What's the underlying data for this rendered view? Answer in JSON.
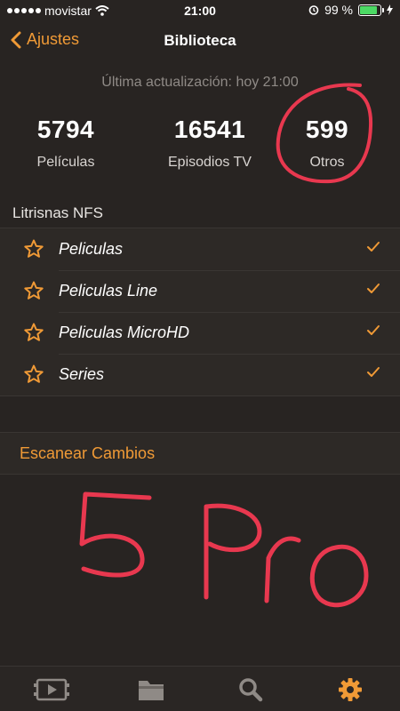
{
  "status": {
    "carrier": "movistar",
    "time": "21:00",
    "battery": "99 %"
  },
  "nav": {
    "back_label": "Ajustes",
    "title": "Biblioteca"
  },
  "updated": "Última actualización: hoy 21:00",
  "stats": [
    {
      "value": "5794",
      "label": "Películas"
    },
    {
      "value": "16541",
      "label": "Episodios TV"
    },
    {
      "value": "599",
      "label": "Otros"
    }
  ],
  "section_title": "Litrisnas NFS",
  "sources": [
    {
      "name": "Peliculas"
    },
    {
      "name": "Peliculas Line"
    },
    {
      "name": "Peliculas MicroHD"
    },
    {
      "name": "Series"
    }
  ],
  "scan_label": "Escanear Cambios",
  "annotation_text": "5 Pro",
  "colors": {
    "accent": "#f09a36",
    "background": "#282422",
    "annotation": "#e8384f"
  },
  "tabs": [
    "video-icon",
    "folder-icon",
    "search-icon",
    "gear-icon"
  ]
}
